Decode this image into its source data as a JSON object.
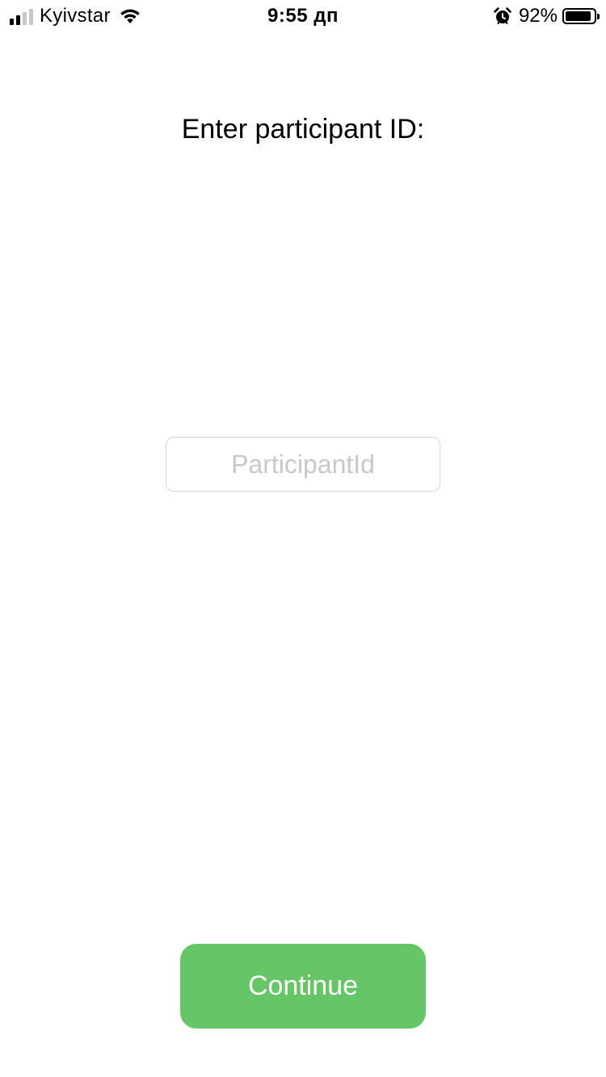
{
  "status_bar": {
    "carrier": "Kyivstar",
    "signal_bars_active": 2,
    "signal_bars_total": 4,
    "time": "9:55 дп",
    "battery_percent": "92%",
    "battery_level": 0.92,
    "icons": {
      "wifi": "wifi-icon",
      "alarm": "alarm-clock-icon",
      "battery": "battery-icon",
      "signal": "cellular-signal-icon"
    }
  },
  "main": {
    "prompt": "Enter participant ID:",
    "participant_input": {
      "value": "",
      "placeholder": "ParticipantId"
    },
    "continue_label": "Continue"
  },
  "colors": {
    "accent": "#66c567",
    "background": "#ffffff",
    "placeholder": "#c7c7cd"
  }
}
